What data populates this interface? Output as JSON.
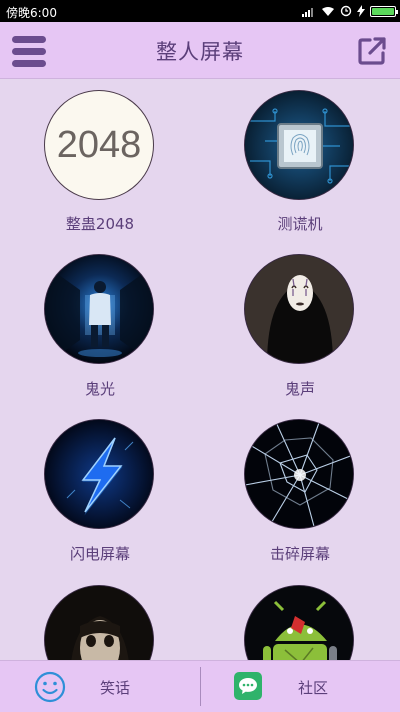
{
  "status_bar": {
    "time": "傍晚6:00",
    "battery_level_percent": 100
  },
  "header": {
    "title": "整人屏幕",
    "menu_icon": "hamburger-menu-icon",
    "share_icon": "external-link-icon"
  },
  "grid": {
    "items": [
      {
        "label": "整蛊2048",
        "icon_text": "2048",
        "image": "2048-tile"
      },
      {
        "label": "测谎机",
        "image": "fingerprint-scanner"
      },
      {
        "label": "鬼光",
        "image": "dark-corridor-figure"
      },
      {
        "label": "鬼声",
        "image": "no-face-mask"
      },
      {
        "label": "闪电屏幕",
        "image": "blue-lightning-bolt"
      },
      {
        "label": "击碎屏幕",
        "image": "shattered-glass"
      },
      {
        "label": "",
        "image": "ghost-face"
      },
      {
        "label": "",
        "image": "broken-android-robot"
      }
    ]
  },
  "bottom_bar": {
    "tabs": [
      {
        "label": "笑话",
        "icon": "smiley-face-icon"
      },
      {
        "label": "社区",
        "icon": "chat-bubble-icon"
      }
    ]
  },
  "colors": {
    "background": "#e5d6ee",
    "header": "#e6c6f4",
    "accent": "#6b4c8e",
    "text": "#5b3f7a"
  }
}
